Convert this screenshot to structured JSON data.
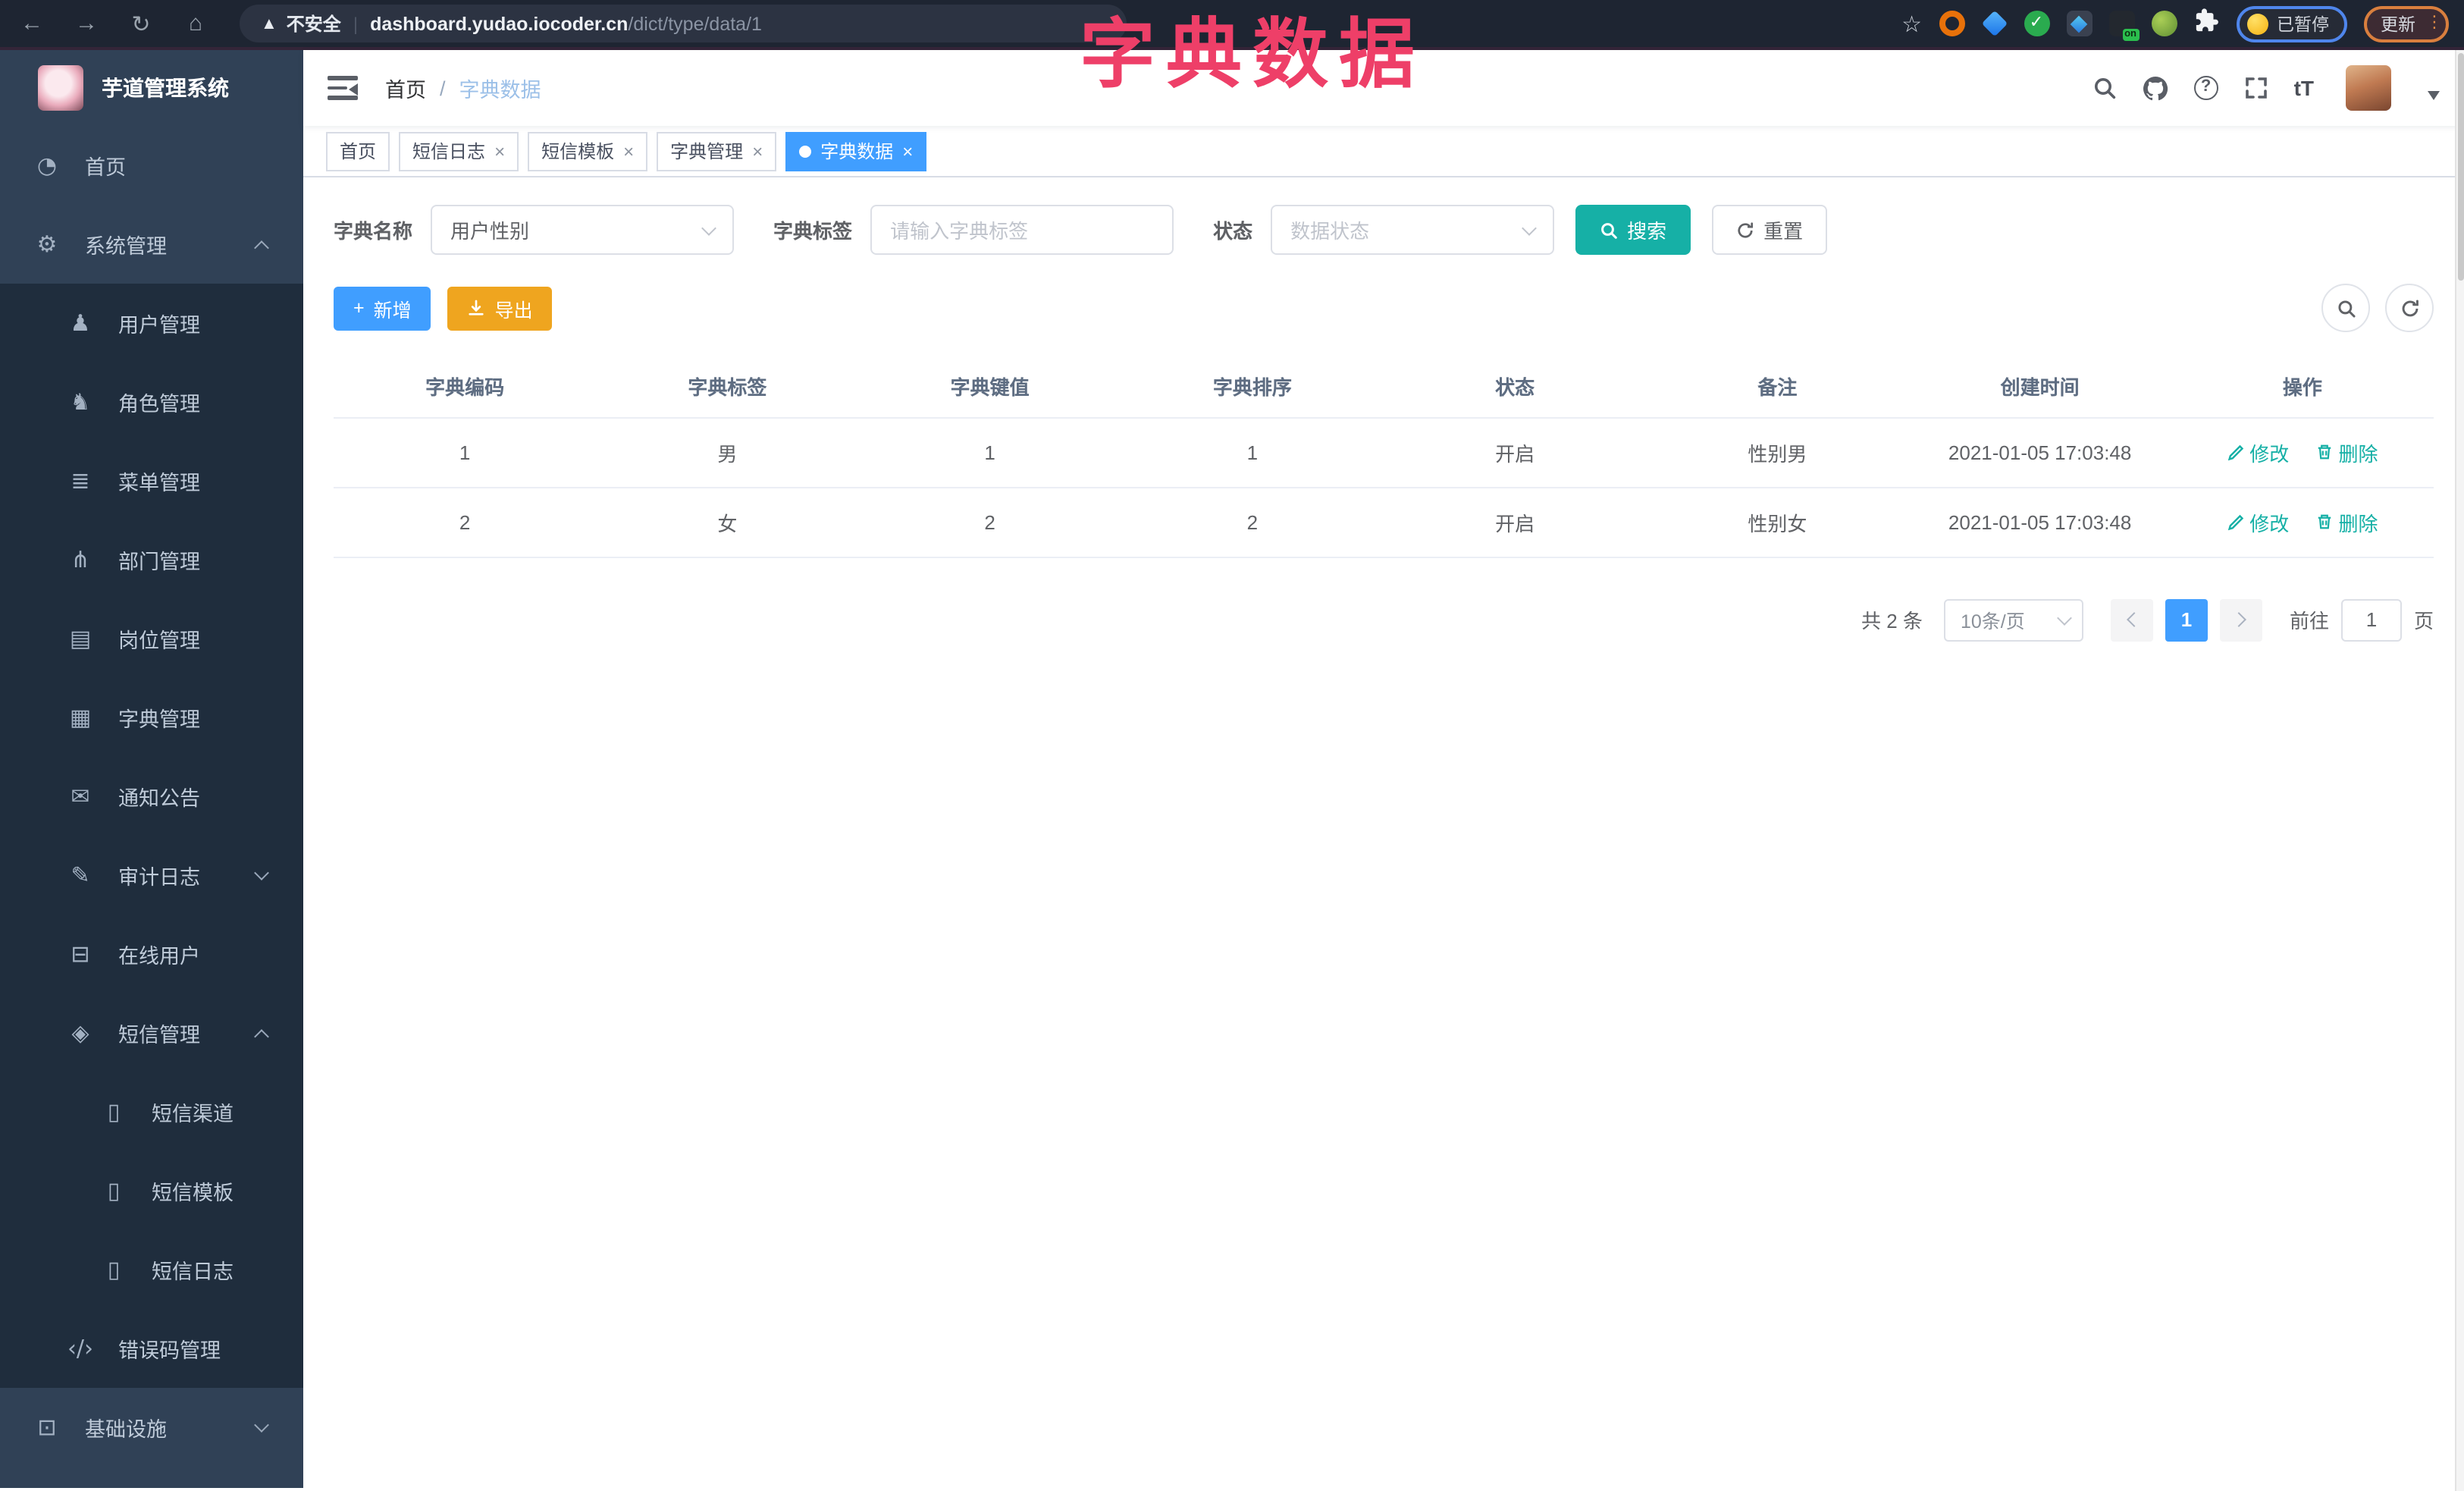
{
  "browser": {
    "security_label": "不安全",
    "url_host": "dashboard.yudao.iocoder.cn",
    "url_path": "/dict/type/data/1",
    "paused_badge": "已暂停",
    "update_button": "更新",
    "nav_icons": [
      "back-icon",
      "forward-icon",
      "reload-icon",
      "home-icon"
    ],
    "extension_icons": [
      "star-icon",
      "orange-ring-extension-icon",
      "blue-gem-extension-icon",
      "green-check-extension-icon",
      "diamond-extension-icon",
      "on-badge-extension-icon",
      "leaf-extension-icon",
      "puzzle-extensions-icon"
    ]
  },
  "overlay": {
    "title": "字典数据",
    "color": "#ee3f68"
  },
  "sidebar": {
    "app_title": "芋道管理系统",
    "items": [
      {
        "label": "首页",
        "icon": "dashboard-icon",
        "level": 1,
        "sub": false,
        "arrow": "none"
      },
      {
        "label": "系统管理",
        "icon": "gear-icon",
        "level": 1,
        "sub": false,
        "arrow": "up"
      },
      {
        "label": "用户管理",
        "icon": "user-icon",
        "level": 2,
        "sub": true,
        "arrow": "none"
      },
      {
        "label": "角色管理",
        "icon": "roles-icon",
        "level": 2,
        "sub": true,
        "arrow": "none"
      },
      {
        "label": "菜单管理",
        "icon": "menu-list-icon",
        "level": 2,
        "sub": true,
        "arrow": "none"
      },
      {
        "label": "部门管理",
        "icon": "dept-tree-icon",
        "level": 2,
        "sub": true,
        "arrow": "none"
      },
      {
        "label": "岗位管理",
        "icon": "post-icon",
        "level": 2,
        "sub": true,
        "arrow": "none"
      },
      {
        "label": "字典管理",
        "icon": "dict-book-icon",
        "level": 2,
        "sub": true,
        "arrow": "none"
      },
      {
        "label": "通知公告",
        "icon": "notice-icon",
        "level": 2,
        "sub": true,
        "arrow": "none"
      },
      {
        "label": "审计日志",
        "icon": "audit-log-icon",
        "level": 2,
        "sub": true,
        "arrow": "down"
      },
      {
        "label": "在线用户",
        "icon": "online-user-icon",
        "level": 2,
        "sub": true,
        "arrow": "none"
      },
      {
        "label": "短信管理",
        "icon": "sms-shield-icon",
        "level": 2,
        "sub": true,
        "arrow": "up"
      },
      {
        "label": "短信渠道",
        "icon": "phone-icon",
        "level": 3,
        "sub": true,
        "arrow": "none"
      },
      {
        "label": "短信模板",
        "icon": "phone-icon",
        "level": 3,
        "sub": true,
        "arrow": "none"
      },
      {
        "label": "短信日志",
        "icon": "phone-icon",
        "level": 3,
        "sub": true,
        "arrow": "none"
      },
      {
        "label": "错误码管理",
        "icon": "code-icon",
        "level": 2,
        "sub": true,
        "arrow": "none"
      },
      {
        "label": "基础设施",
        "icon": "infra-icon",
        "level": 1,
        "sub": false,
        "arrow": "down"
      }
    ]
  },
  "header": {
    "breadcrumb_home": "首页",
    "breadcrumb_current": "字典数据",
    "icons": [
      "search-icon",
      "github-icon",
      "help-icon",
      "fullscreen-icon",
      "font-size-icon",
      "avatar",
      "chevron-down-icon"
    ]
  },
  "tabs": [
    {
      "label": "首页",
      "closable": false,
      "active": false
    },
    {
      "label": "短信日志",
      "closable": true,
      "active": false
    },
    {
      "label": "短信模板",
      "closable": true,
      "active": false
    },
    {
      "label": "字典管理",
      "closable": true,
      "active": false
    },
    {
      "label": "字典数据",
      "closable": true,
      "active": true
    }
  ],
  "filters": {
    "dict_name_label": "字典名称",
    "dict_name_value": "用户性别",
    "dict_label_label": "字典标签",
    "dict_label_placeholder": "请输入字典标签",
    "status_label": "状态",
    "status_placeholder": "数据状态",
    "search_button": "搜索",
    "reset_button": "重置"
  },
  "toolbar": {
    "add_button": "新增",
    "export_button": "导出"
  },
  "table": {
    "headers": [
      "字典编码",
      "字典标签",
      "字典键值",
      "字典排序",
      "状态",
      "备注",
      "创建时间",
      "操作"
    ],
    "rows": [
      {
        "code": "1",
        "label": "男",
        "value": "1",
        "sort": "1",
        "status": "开启",
        "remark": "性别男",
        "created": "2021-01-05 17:03:48",
        "edit": "修改",
        "delete": "删除"
      },
      {
        "code": "2",
        "label": "女",
        "value": "2",
        "sort": "2",
        "status": "开启",
        "remark": "性别女",
        "created": "2021-01-05 17:03:48",
        "edit": "修改",
        "delete": "删除"
      }
    ]
  },
  "pagination": {
    "total": "共 2 条",
    "page_size": "10条/页",
    "current_page": "1",
    "goto_label": "前往",
    "goto_value": "1",
    "page_unit": "页"
  },
  "colors": {
    "primary": "#409EFF",
    "teal": "#16b0a6",
    "warning": "#EFA51F",
    "overlay_pink": "#ee3f68",
    "sidebar_bg": "#304156",
    "submenu_bg": "#1f2d3d"
  }
}
